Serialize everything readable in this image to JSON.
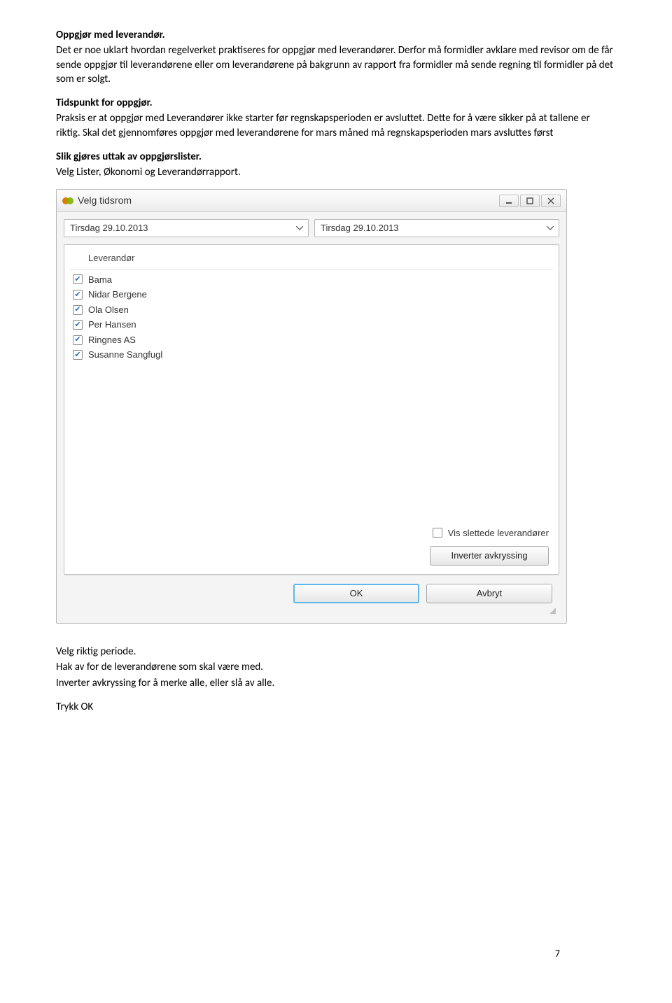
{
  "doc": {
    "heading1": "Oppgjør med leverandør.",
    "p1": "Det er noe uklart hvordan regelverket praktiseres for oppgjør med leverandører. Derfor må formidler avklare med revisor om de får sende oppgjør til leverandørene eller om leverandørene på bakgrunn av rapport fra formidler må sende regning til formidler på det som er solgt.",
    "heading2": "Tidspunkt for oppgjør.",
    "p2": "Praksis er at oppgjør med Leverandører ikke starter før regnskapsperioden er avsluttet. Dette for å være sikker på at tallene er riktig. Skal det gjennomføres oppgjør med leverandørene for mars måned må regnskapsperioden mars avsluttes først",
    "heading3": "Slik gjøres uttak av oppgjørslister.",
    "p3": "Velg Lister, Økonomi og Leverandørrapport.",
    "p4a": "Velg riktig periode.",
    "p4b": "Hak av for de leverandørene som skal være med.",
    "p4c": "Inverter avkryssing for å merke alle, eller slå av alle.",
    "p5": "Trykk OK",
    "pageNumber": "7"
  },
  "dialog": {
    "title": "Velg tidsrom",
    "dateFrom": "Tirsdag 29.10.2013",
    "dateTo": "Tirsdag 29.10.2013",
    "listHeader": "Leverandør",
    "suppliers": [
      "Bama",
      "Nidar Bergene",
      "Ola Olsen",
      "Per Hansen",
      "Ringnes AS",
      "Susanne Sangfugl"
    ],
    "showDeletedLabel": "Vis slettede leverandører",
    "invertLabel": "Inverter avkryssing",
    "okLabel": "OK",
    "cancelLabel": "Avbryt"
  }
}
